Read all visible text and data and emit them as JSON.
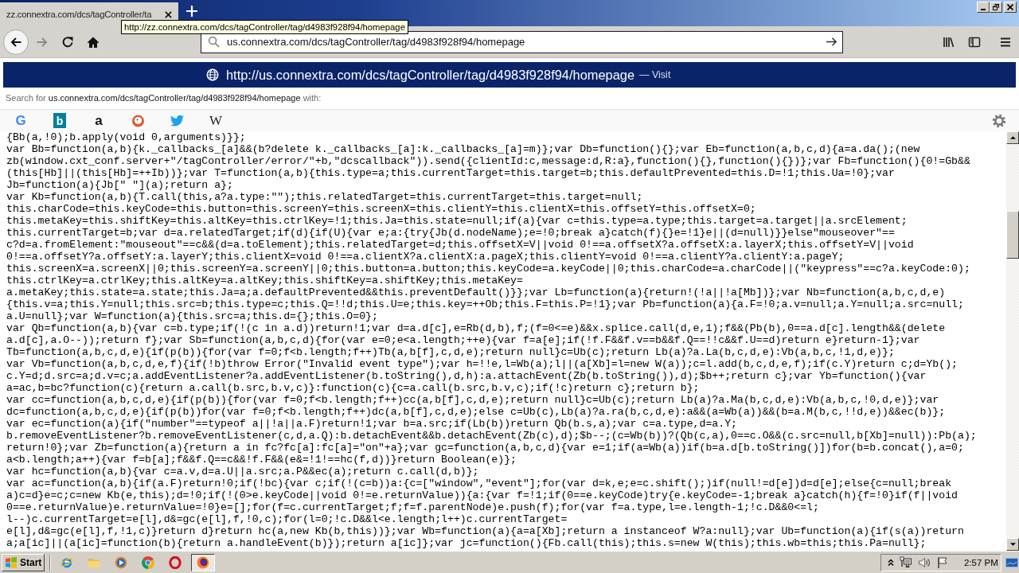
{
  "tabs": [
    {
      "title": "zz.connextra.com/dcs/tagController/ta",
      "selected": true
    }
  ],
  "tooltip": "http://zz.connextra.com/dcs/tagController/tag/d4983f928f94/homepage",
  "toolbar": {
    "nav_buttons": [
      {
        "kind": "back",
        "disabled": false
      },
      {
        "kind": "forward",
        "disabled": true
      },
      {
        "kind": "reload",
        "disabled": false
      },
      {
        "kind": "home",
        "disabled": false
      }
    ],
    "address": {
      "value": "us.connextra.com/dcs/tagController/tag/d4983f928f94/homepage"
    }
  },
  "url_dropdown": {
    "suggestion": {
      "url": "http://us.connextra.com/dcs/tagController/tag/d4983f928f94/homepage",
      "action": "— Visit",
      "selected": true
    },
    "search_hint": "Search for **us.connextra.com/dcs/tagController/tag/d4983f928f94/homepage** with:",
    "search_engines": [
      {
        "kind": "letter",
        "glyph": "G",
        "color": "#4285f4"
      },
      {
        "kind": "tile",
        "glyph": "b",
        "color": "#00809d"
      },
      {
        "kind": "letter",
        "glyph": "a",
        "color": "#111111"
      },
      {
        "kind": "duck",
        "color": "#de5833"
      },
      {
        "kind": "bird",
        "color": "#1da1f2"
      },
      {
        "kind": "serif",
        "glyph": "W",
        "color": "#222222"
      }
    ]
  },
  "code_lines": [
    "{Bb(a,!0);b.apply(void 0,arguments)}};",
    "var Bb=function(a,b){k._callbacks_[a]&&(b?delete k._callbacks_[a]:k._callbacks_[a]=m)};var Db=function(){};var Eb=function(a,b,c,d){a=a.da();(new",
    "zb(window.cxt_conf.server+\"/tagController/error/\"+b,\"dcscallback\")).send({clientId:c,message:d,R:a},function(){},function(){})};var Fb=function(){0!=Gb&&",
    "(this[Hb]||(this[Hb]=++Ib))};var T=function(a,b){this.type=a;this.currentTarget=this.target=b;this.defaultPrevented=this.D=!1;this.Ua=!0};var",
    "Jb=function(a){Jb[\" \"](a);return a};",
    "var Kb=function(a,b){T.call(this,a?a.type:\"\");this.relatedTarget=this.currentTarget=this.target=null;",
    "this.charCode=this.keyCode=this.button=this.screenY=this.screenX=this.clientY=this.clientX=this.offsetY=this.offsetX=0;",
    "this.metaKey=this.shiftKey=this.altKey=this.ctrlKey=!1;this.Ja=this.state=null;if(a){var c=this.type=a.type;this.target=a.target||a.srcElement;",
    "this.currentTarget=b;var d=a.relatedTarget;if(d){if(U){var e;a:{try{Jb(d.nodeName);e=!0;break a}catch(f){}e=!1}e||(d=null)}}else\"mouseover\"==",
    "c?d=a.fromElement:\"mouseout\"==c&&(d=a.toElement);this.relatedTarget=d;this.offsetX=V||void 0!==a.offsetX?a.offsetX:a.layerX;this.offsetY=V||void",
    "0!==a.offsetY?a.offsetY:a.layerY;this.clientX=void 0!==a.clientX?a.clientX:a.pageX;this.clientY=void 0!==a.clientY?a.clientY:a.pageY;",
    "this.screenX=a.screenX||0;this.screenY=a.screenY||0;this.button=a.button;this.keyCode=a.keyCode||0;this.charCode=a.charCode||(\"keypress\"==c?a.keyCode:0);",
    "this.ctrlKey=a.ctrlKey;this.altKey=a.altKey;this.shiftKey=a.shiftKey;this.metaKey=",
    "a.metaKey;this.state=a.state;this.Ja=a;a.defaultPrevented&&this.preventDefault()}};var Lb=function(a){return!(!a||!a[Mb])};var Nb=function(a,b,c,d,e)",
    "{this.v=a;this.Y=null;this.src=b;this.type=c;this.Q=!!d;this.U=e;this.key=++Ob;this.F=this.P=!1};var Pb=function(a){a.F=!0;a.v=null;a.Y=null;a.src=null;",
    "a.U=null};var W=function(a){this.src=a;this.d={};this.O=0};",
    "var Qb=function(a,b){var c=b.type;if(!(c in a.d))return!1;var d=a.d[c],e=Rb(d,b),f;(f=0<=e)&&x.splice.call(d,e,1);f&&(Pb(b),0==a.d[c].length&&(delete",
    "a.d[c],a.O--));return f};var Sb=function(a,b,c,d){for(var e=0;e<a.length;++e){var f=a[e];if(!f.F&&f.v==b&&f.Q==!!c&&f.U==d)return e}return-1};var",
    "Tb=function(a,b,c,d,e){if(p(b)){for(var f=0;f<b.length;f++)Tb(a,b[f],c,d,e);return null}c=Ub(c);return Lb(a)?a.La(b,c,d,e):Vb(a,b,c,!1,d,e)};",
    "var Vb=function(a,b,c,d,e,f){if(!b)throw Error(\"Invalid event type\");var h=!!e,l=Wb(a);l||(a[Xb]=l=new W(a));c=l.add(b,c,d,e,f);if(c.Y)return c;d=Yb();",
    "c.Y=d;d.src=a;d.v=c;a.addEventListener?a.addEventListener(b.toString(),d,h):a.attachEvent(Zb(b.toString()),d);$b++;return c};var Yb=function(){var",
    "a=ac,b=bc?function(c){return a.call(b.src,b.v,c)}:function(c){c=a.call(b.src,b.v,c);if(!c)return c};return b};",
    "var cc=function(a,b,c,d,e){if(p(b)){for(var f=0;f<b.length;f++)cc(a,b[f],c,d,e);return null}c=Ub(c);return Lb(a)?a.Ma(b,c,d,e):Vb(a,b,c,!0,d,e)};var",
    "dc=function(a,b,c,d,e){if(p(b))for(var f=0;f<b.length;f++)dc(a,b[f],c,d,e);else c=Ub(c),Lb(a)?a.ra(b,c,d,e):a&&(a=Wb(a))&&(b=a.M(b,c,!!d,e))&&ec(b)};",
    "var ec=function(a){if(\"number\"==typeof a||!a||a.F)return!1;var b=a.src;if(Lb(b))return Qb(b.s,a);var c=a.type,d=a.Y;",
    "b.removeEventListener?b.removeEventListener(c,d,a.Q):b.detachEvent&&b.detachEvent(Zb(c),d);$b--;(c=Wb(b))?(Qb(c,a),0==c.O&&(c.src=null,b[Xb]=null)):Pb(a);",
    "return!0};var Zb=function(a){return a in fc?fc[a]:fc[a]=\"on\"+a};var gc=function(a,b,c,d){var e=1;if(a=Wb(a))if(b=a.d[b.toString()])for(b=b.concat(),a=0;",
    "a<b.length;a++){var f=b[a];f&&f.Q==c&&!f.F&&(e&=!1!==hc(f,d))}return Boolean(e)};",
    "var hc=function(a,b){var c=a.v,d=a.U||a.src;a.P&&ec(a);return c.call(d,b)};",
    "var ac=function(a,b){if(a.F)return!0;if(!bc){var c;if(!(c=b))a:{c=[\"window\",\"event\"];for(var d=k,e;e=c.shift();)if(null!=d[e])d=d[e];else{c=null;break",
    "a)c=d}e=c;c=new Kb(e,this);d=!0;if(!(0>e.keyCode||void 0!=e.returnValue)){a:{var f=!1;if(0==e.keyCode)try{e.keyCode=-1;break a}catch(h){f=!0}if(f||void",
    "0==e.returnValue)e.returnValue=!0}e=[];for(f=c.currentTarget;f;f=f.parentNode)e.push(f);for(var f=a.type,l=e.length-1;!c.D&&0<=l;",
    "l--)c.currentTarget=e[l],d&=gc(e[l],f,!0,c);for(l=0;!c.D&&l<e.length;l++)c.currentTarget=",
    "e[l],d&=gc(e[l],f,!1,c)}return d}return hc(a,new Kb(b,this))};var Wb=function(a){a=a[Xb];return a instanceof W?a:null};var Ub=function(a){if(s(a))return",
    "a;a[ic]||(a[ic]=function(b){return a.handleEvent(b)});return a[ic]};var jc=function(){Fb.call(this);this.s=new W(this);this.wb=this;this.Pa=null};"
  ],
  "taskbar": {
    "start": "Start",
    "tasks": [
      {
        "selected": true
      }
    ],
    "clock": "2:57 PM"
  }
}
